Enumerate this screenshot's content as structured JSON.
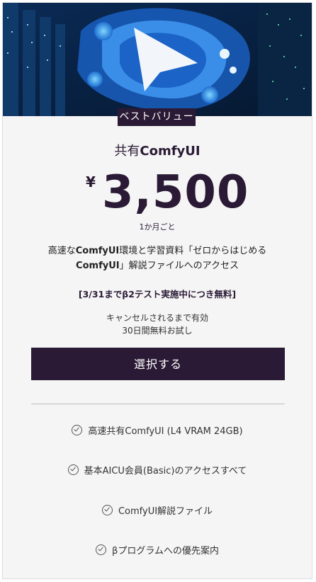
{
  "badge": "ベストバリュー",
  "plan": {
    "name_prefix": "共有",
    "name_bold": "ComfyUI"
  },
  "price": {
    "currency": "¥",
    "amount": "3,500",
    "period": "1か月ごと"
  },
  "description": {
    "line1_pre": "高速な",
    "line1_bold": "ComfyUI",
    "line1_post": "環境と学習資料「ゼロからはじめる",
    "line2_bold": "ComfyUI",
    "line2_post": "」解説ファイルへのアクセス"
  },
  "beta_note": "[3/31までβ2テスト実施中につき無料]",
  "trial": {
    "line1": "キャンセルされるまで有効",
    "line2": "30日間無料お試し"
  },
  "select_button": "選択する",
  "features": [
    "高速共有ComfyUI (L4 VRAM 24GB)",
    "基本AICU会員(Basic)のアクセスすべて",
    "ComfyUI解説ファイル",
    "βプログラムへの優先案内"
  ],
  "colors": {
    "brand_dark": "#2a1a35",
    "card_bg": "#f5f5f5"
  }
}
